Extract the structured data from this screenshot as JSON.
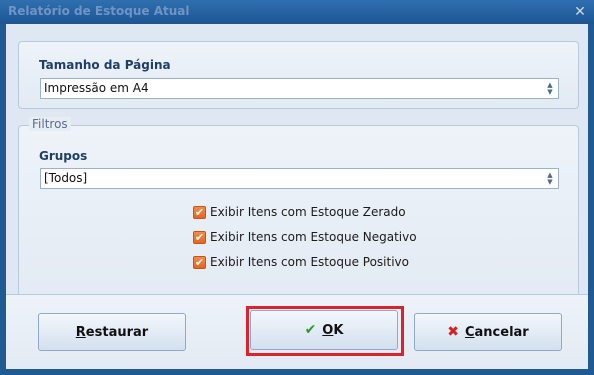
{
  "window": {
    "title": "Relatório de Estoque Atual",
    "close_label": "✕"
  },
  "page_size": {
    "label": "Tamanho da Página",
    "selected": "Impressão em A4"
  },
  "filters": {
    "legend": "Filtros",
    "groups_label": "Grupos",
    "groups_selected": "[Todos]",
    "checkboxes": [
      {
        "label": "Exibir Itens com Estoque Zerado",
        "checked": true
      },
      {
        "label": "Exibir Itens com Estoque Negativo",
        "checked": true
      },
      {
        "label": "Exibir Itens com Estoque Positivo",
        "checked": true
      }
    ]
  },
  "buttons": {
    "restore_first": "R",
    "restore_rest": "estaurar",
    "ok_first": "O",
    "ok_rest": "K",
    "cancel_first": "C",
    "cancel_rest": "ancelar"
  },
  "colors": {
    "accent": "#1f5a93",
    "check": "#e46720",
    "highlight": "#e0202a",
    "ok_icon": "#2e9a2e",
    "cancel_icon": "#d92020"
  },
  "icons": {
    "ok": "checkmark-icon",
    "cancel": "x-icon"
  }
}
